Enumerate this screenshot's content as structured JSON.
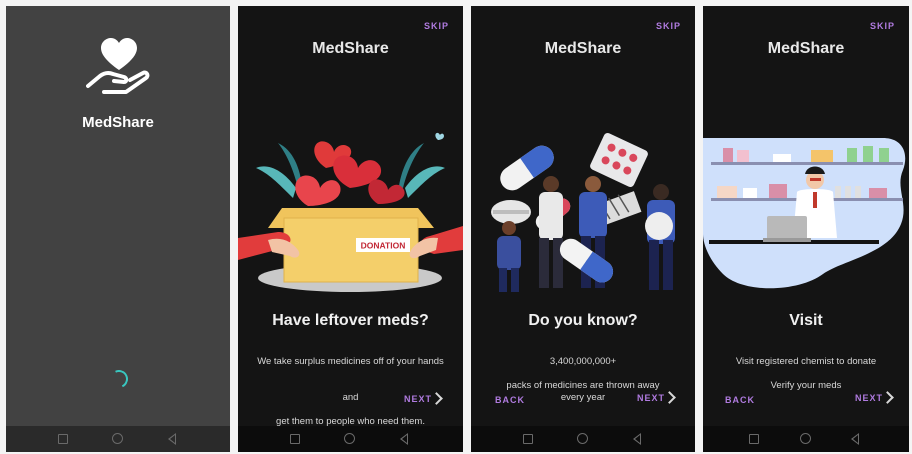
{
  "splash": {
    "app_name": "MedShare",
    "logo_icon": "heart-hand-icon",
    "spinner_color": "#39c7c0"
  },
  "screen1": {
    "skip": "SKIP",
    "app_title": "MedShare",
    "box_label": "DONATION",
    "heading": "Have leftover meds?",
    "line1": "We take surplus medicines off of your hands",
    "line2": "and",
    "line3": "get them to people who need them.",
    "next": "NEXT"
  },
  "screen2": {
    "skip": "SKIP",
    "app_title": "MedShare",
    "heading": "Do you know?",
    "stat": "3,400,000,000+",
    "line1": "packs of medicines are thrown away every year",
    "back": "BACK",
    "next": "NEXT"
  },
  "screen3": {
    "skip": "SKIP",
    "app_title": "MedShare",
    "heading": "Visit",
    "line1": "Visit registered chemist to donate",
    "line2": "Verify your meds",
    "back": "BACK",
    "next": "NEXT"
  },
  "colors": {
    "accent": "#b07be0",
    "screen_bg": "#141414",
    "splash_bg": "#424242"
  }
}
